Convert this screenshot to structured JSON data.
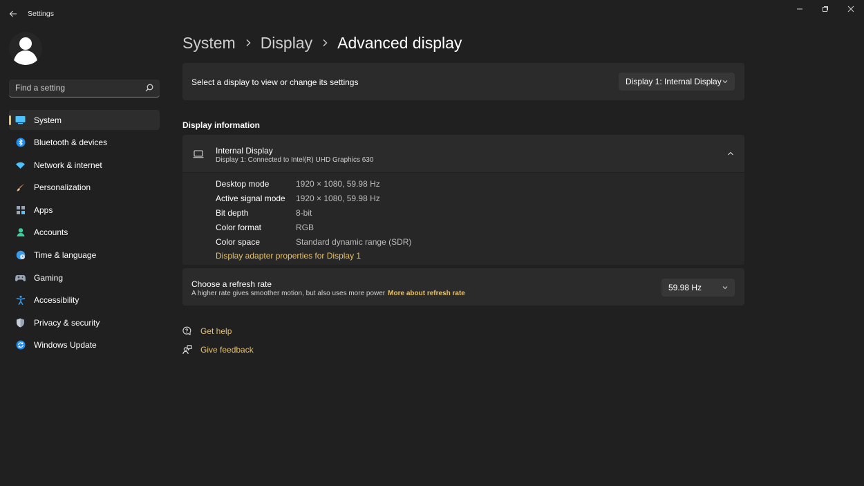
{
  "titlebar": {
    "app_title": "Settings",
    "back_icon": "back-arrow-icon",
    "minimize_icon": "minimize-icon",
    "restore_icon": "restore-icon",
    "close_icon": "close-icon"
  },
  "sidebar": {
    "search": {
      "placeholder": "Find a setting",
      "value": ""
    },
    "items": [
      {
        "label": "System",
        "icon": "display-icon",
        "active": true
      },
      {
        "label": "Bluetooth & devices",
        "icon": "bluetooth-icon"
      },
      {
        "label": "Network & internet",
        "icon": "wifi-icon"
      },
      {
        "label": "Personalization",
        "icon": "brush-icon"
      },
      {
        "label": "Apps",
        "icon": "apps-icon"
      },
      {
        "label": "Accounts",
        "icon": "person-icon"
      },
      {
        "label": "Time & language",
        "icon": "globe-clock-icon"
      },
      {
        "label": "Gaming",
        "icon": "gamepad-icon"
      },
      {
        "label": "Accessibility",
        "icon": "accessibility-icon"
      },
      {
        "label": "Privacy & security",
        "icon": "shield-icon"
      },
      {
        "label": "Windows Update",
        "icon": "update-icon"
      }
    ]
  },
  "breadcrumb": {
    "items": [
      "System",
      "Display",
      "Advanced display"
    ]
  },
  "display_select": {
    "label": "Select a display to view or change its settings",
    "value": "Display 1: Internal Display"
  },
  "display_info": {
    "section_title": "Display information",
    "device_name": "Internal Display",
    "device_subtitle": "Display 1: Connected to Intel(R) UHD Graphics 630",
    "rows": [
      {
        "key": "Desktop mode",
        "value": "1920 × 1080, 59.98 Hz"
      },
      {
        "key": "Active signal mode",
        "value": "1920 × 1080, 59.98 Hz"
      },
      {
        "key": "Bit depth",
        "value": "8-bit"
      },
      {
        "key": "Color format",
        "value": "RGB"
      },
      {
        "key": "Color space",
        "value": "Standard dynamic range (SDR)"
      }
    ],
    "adapter_link": "Display adapter properties for Display 1"
  },
  "refresh_rate": {
    "title": "Choose a refresh rate",
    "description": "A higher rate gives smoother motion, but also uses more power",
    "more_link": "More about refresh rate",
    "value": "59.98 Hz"
  },
  "help": {
    "get_help": "Get help",
    "give_feedback": "Give feedback"
  },
  "colors": {
    "background": "#202020",
    "card": "#2b2b2b",
    "accent": "#e3c16f",
    "system_icon": "#4cc2ff"
  }
}
